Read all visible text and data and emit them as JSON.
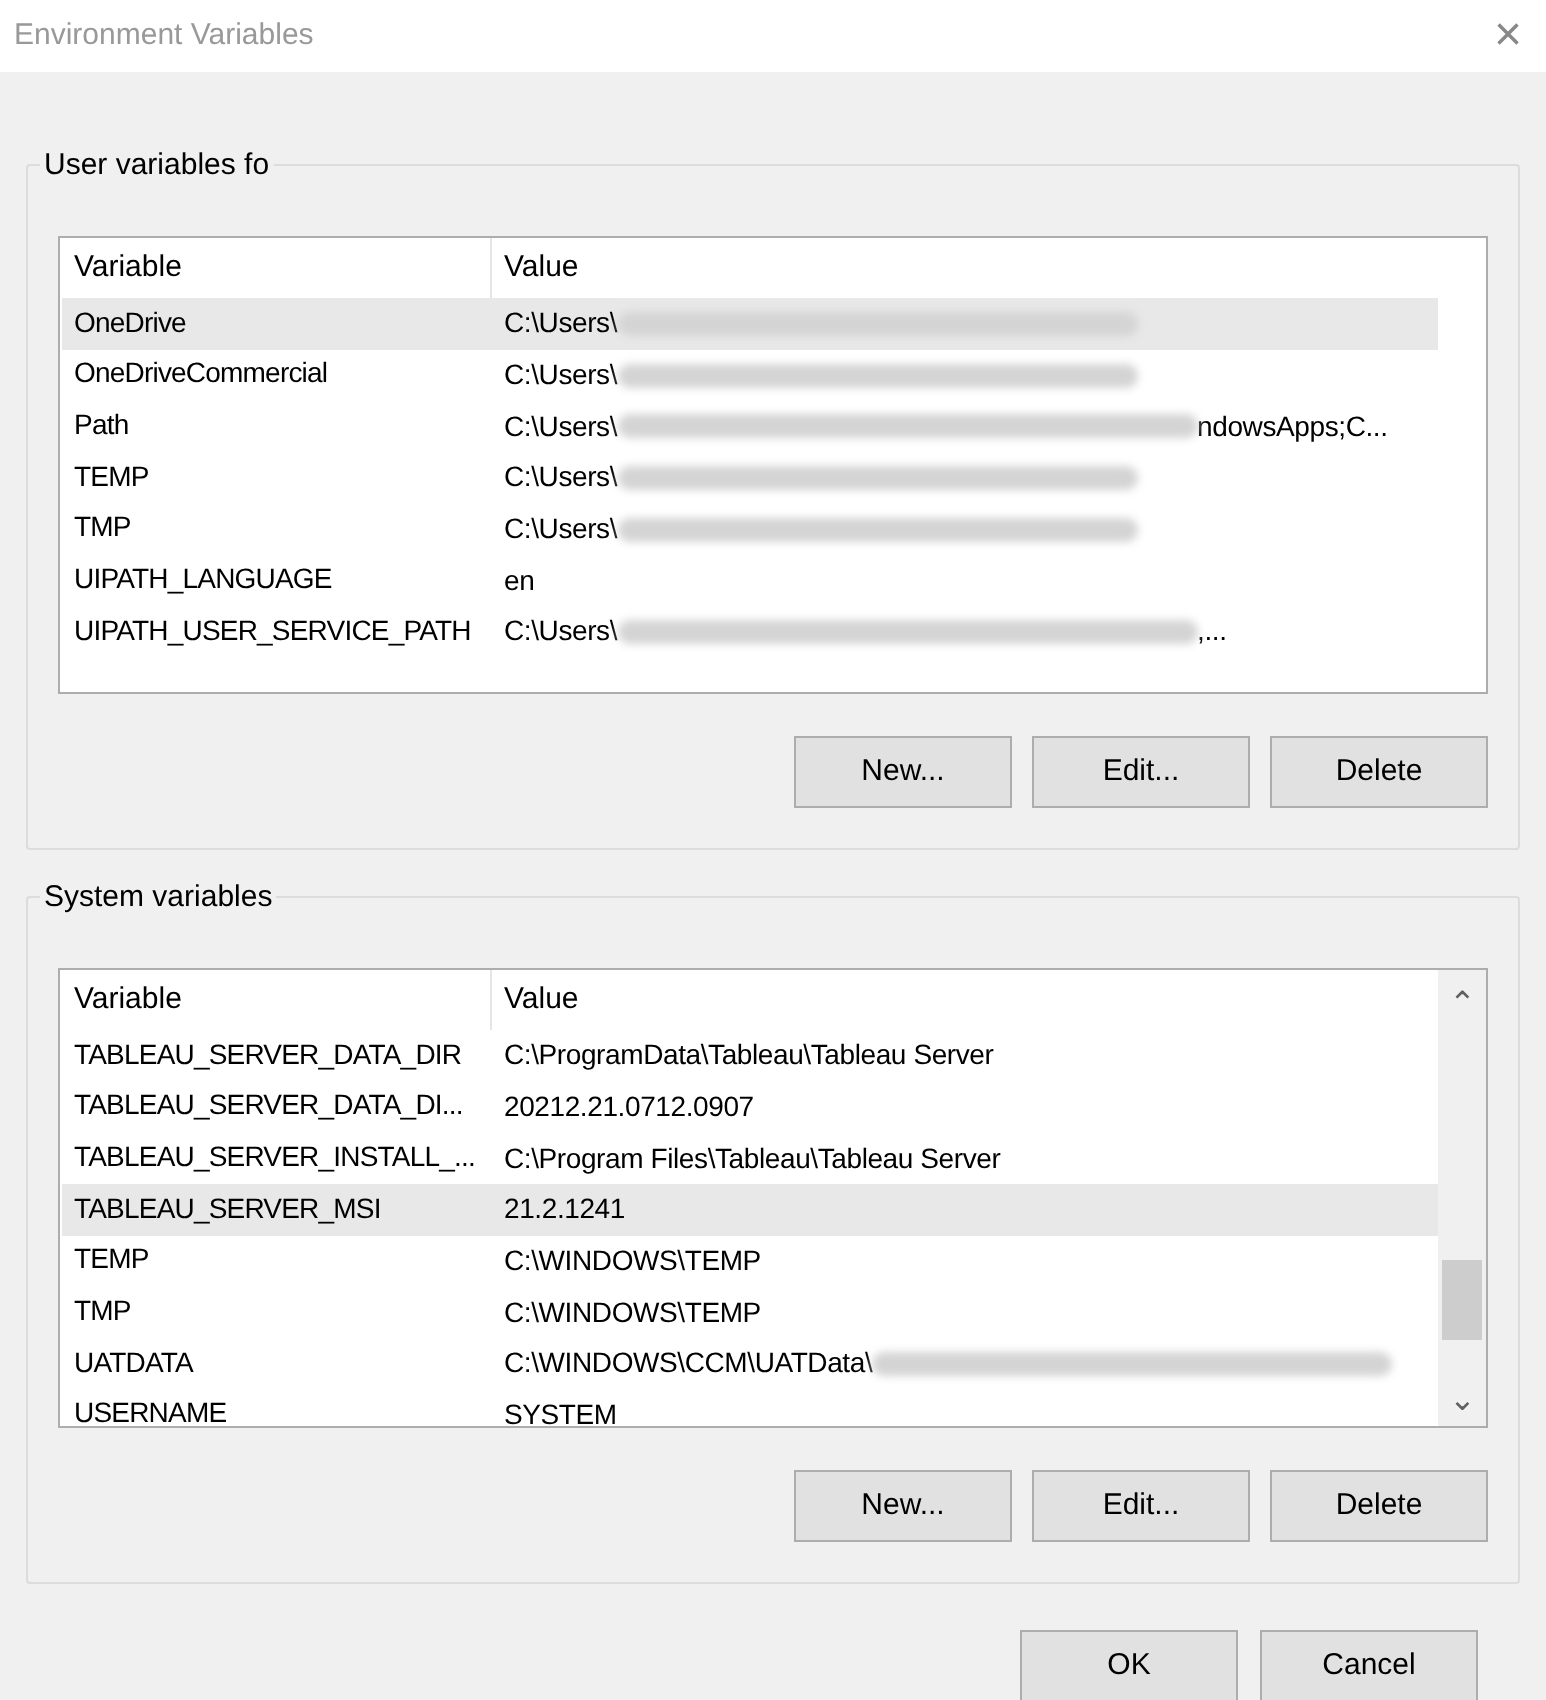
{
  "window": {
    "title": "Environment Variables",
    "close": "×"
  },
  "user_variables": {
    "title": "User variables fo",
    "columns": [
      "Variable",
      "Value"
    ],
    "rows": [
      {
        "variable": "OneDrive",
        "value": "C:\\Users\\",
        "redacted": true,
        "selected": true
      },
      {
        "variable": "OneDriveCommercial",
        "value": "C:\\Users\\",
        "redacted": true,
        "selected": false
      },
      {
        "variable": "Path",
        "value": "C:\\Users\\",
        "redacted": true,
        "tail": "ndowsApps;C...",
        "selected": false
      },
      {
        "variable": "TEMP",
        "value": "C:\\Users\\",
        "redacted": true,
        "selected": false
      },
      {
        "variable": "TMP",
        "value": "C:\\Users\\",
        "redacted": true,
        "selected": false
      },
      {
        "variable": "UIPATH_LANGUAGE",
        "value": "en",
        "redacted": false,
        "selected": false
      },
      {
        "variable": "UIPATH_USER_SERVICE_PATH",
        "value": "C:\\Users\\",
        "redacted": true,
        "tail": ",...",
        "selected": false
      }
    ],
    "buttons": [
      "New...",
      "Edit...",
      "Delete"
    ]
  },
  "system_variables": {
    "title": "System variables",
    "columns": [
      "Variable",
      "Value"
    ],
    "rows": [
      {
        "variable": "TABLEAU_SERVER_DATA_DIR",
        "value": "C:\\ProgramData\\Tableau\\Tableau Server",
        "redacted": false,
        "selected": false
      },
      {
        "variable": "TABLEAU_SERVER_DATA_DI...",
        "value": "20212.21.0712.0907",
        "redacted": false,
        "selected": false
      },
      {
        "variable": "TABLEAU_SERVER_INSTALL_...",
        "value": "C:\\Program Files\\Tableau\\Tableau Server",
        "redacted": false,
        "selected": false
      },
      {
        "variable": "TABLEAU_SERVER_MSI",
        "value": "21.2.1241",
        "redacted": false,
        "selected": true
      },
      {
        "variable": "TEMP",
        "value": "C:\\WINDOWS\\TEMP",
        "redacted": false,
        "selected": false
      },
      {
        "variable": "TMP",
        "value": "C:\\WINDOWS\\TEMP",
        "redacted": false,
        "selected": false
      },
      {
        "variable": "UATDATA",
        "value": "C:\\WINDOWS\\CCM\\UATData\\",
        "redacted": true,
        "selected": false
      },
      {
        "variable": "USERNAME",
        "value": "SYSTEM",
        "redacted": false,
        "selected": false
      }
    ],
    "scroll_up": "⌃",
    "scroll_down": "⌄",
    "buttons": [
      "New...",
      "Edit...",
      "Delete"
    ]
  },
  "buttons": [
    "OK",
    "Cancel"
  ]
}
